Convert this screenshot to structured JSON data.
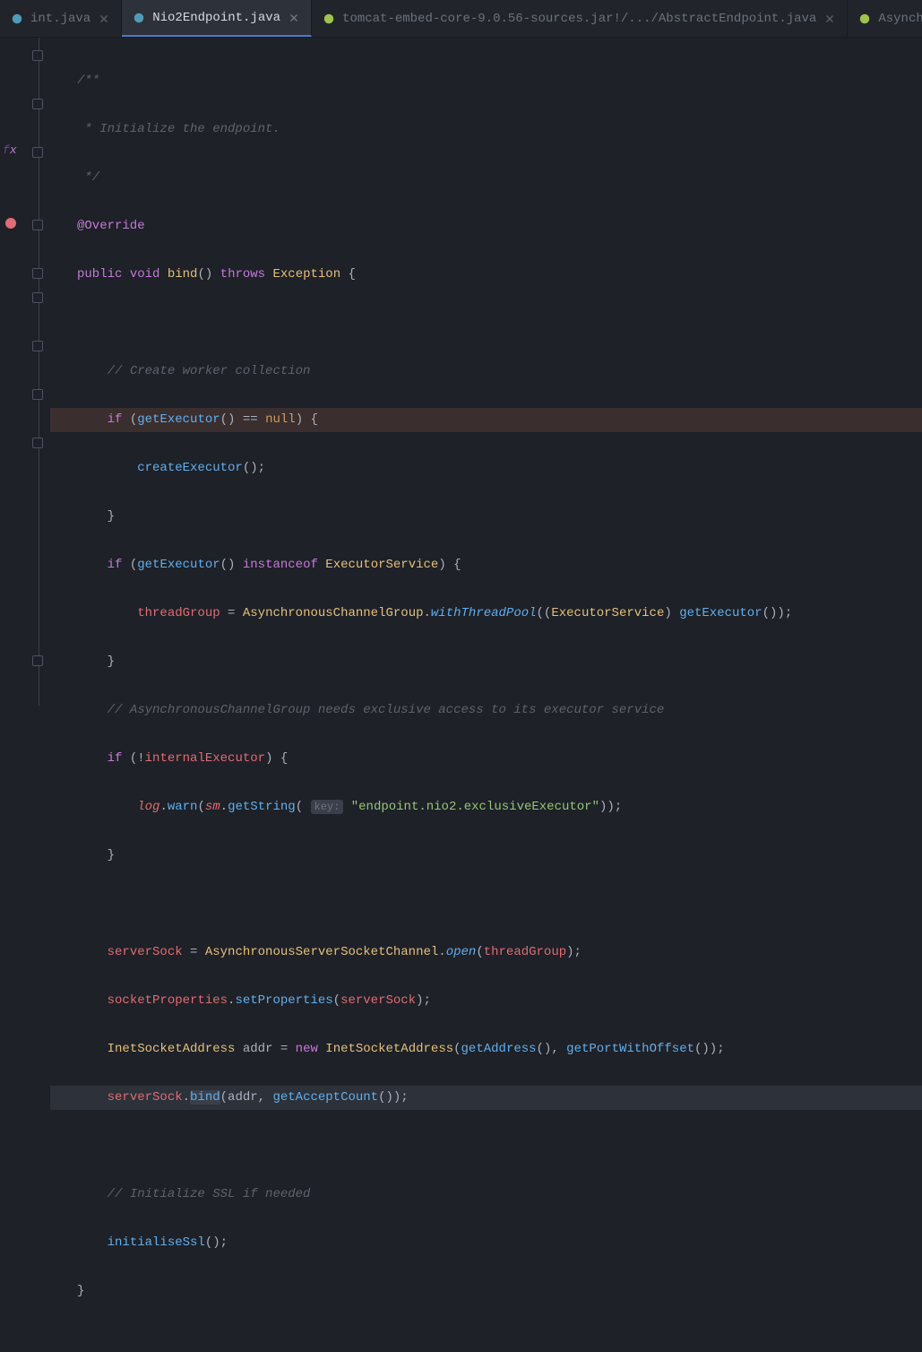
{
  "tabs": [
    {
      "label": "int.java",
      "active": false,
      "closable": true,
      "iconColor": "#519aba"
    },
    {
      "label": "Nio2Endpoint.java",
      "active": true,
      "closable": true,
      "iconColor": "#519aba"
    },
    {
      "label": "tomcat-embed-core-9.0.56-sources.jar!/.../AbstractEndpoint.java",
      "active": false,
      "closable": true,
      "iconColor": "#a0c24f"
    },
    {
      "label": "AsynchronousServerSocketCha",
      "active": false,
      "closable": false,
      "iconColor": "#a0c24f"
    }
  ],
  "code": {
    "l1": "/**",
    "l2": " * Initialize the endpoint.",
    "l3": " */",
    "l4_annotation": "@Override",
    "l5_public": "public",
    "l5_void": "void",
    "l5_bind": "bind",
    "l5_throws": "throws",
    "l5_exception": "Exception",
    "l7_comment": "// Create worker collection",
    "l8_if": "if",
    "l8_getExecutor": "getExecutor",
    "l8_eq": "==",
    "l8_null": "null",
    "l9_createExecutor": "createExecutor",
    "l11_if": "if",
    "l11_getExecutor": "getExecutor",
    "l11_instanceof": "instanceof",
    "l11_ExecutorService": "ExecutorService",
    "l12_threadGroup": "threadGroup",
    "l12_AsynchronousChannelGroup": "AsynchronousChannelGroup",
    "l12_withThreadPool": "withThreadPool",
    "l12_ExecutorService": "ExecutorService",
    "l12_getExecutor": "getExecutor",
    "l14_comment": "// AsynchronousChannelGroup needs exclusive access to its executor service",
    "l15_if": "if",
    "l15_internalExecutor": "internalExecutor",
    "l16_log": "log",
    "l16_warn": "warn",
    "l16_sm": "sm",
    "l16_getString": "getString",
    "l16_keyhint": "key:",
    "l16_string": "\"endpoint.nio2.exclusiveExecutor\"",
    "l19_serverSock": "serverSock",
    "l19_AsynchronousServerSocketChannel": "AsynchronousServerSocketChannel",
    "l19_open": "open",
    "l19_threadGroup": "threadGroup",
    "l20_socketProperties": "socketProperties",
    "l20_setProperties": "setProperties",
    "l20_serverSock": "serverSock",
    "l21_InetSocketAddress": "InetSocketAddress",
    "l21_addr": "addr",
    "l21_new": "new",
    "l21_InetSocketAddress2": "InetSocketAddress",
    "l21_getAddress": "getAddress",
    "l21_getPortWithOffset": "getPortWithOffset",
    "l22_serverSock": "serverSock",
    "l22_bind": "bind",
    "l22_addr": "addr",
    "l22_getAcceptCount": "getAcceptCount",
    "l24_comment": "// Initialize SSL if needed",
    "l25_initialiseSsl": "initialiseSsl"
  }
}
